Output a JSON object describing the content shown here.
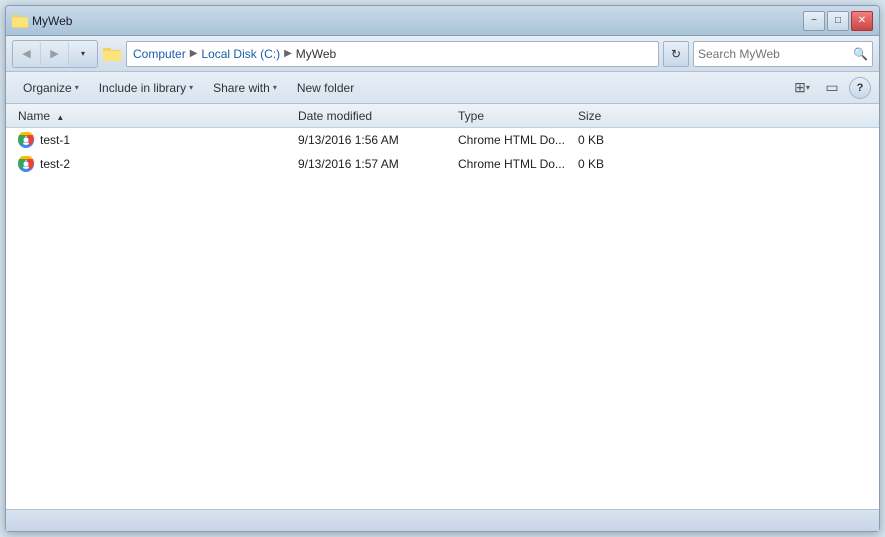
{
  "window": {
    "title": "MyWeb",
    "minimize_label": "−",
    "maximize_label": "□",
    "close_label": "✕"
  },
  "address_bar": {
    "back_label": "◀",
    "forward_label": "▶",
    "dropdown_label": "▾",
    "computer_label": "Computer",
    "localdisk_label": "Local Disk (C:)",
    "current_label": "MyWeb",
    "sep": "▶",
    "refresh_label": "↻",
    "search_placeholder": "Search MyWeb",
    "search_icon_label": "🔍"
  },
  "toolbar": {
    "organize_label": "Organize",
    "include_label": "Include in library",
    "share_label": "Share with",
    "newfolder_label": "New folder",
    "view_label": "▦",
    "view_arrow": "▾",
    "pane_label": "▭",
    "help_label": "?"
  },
  "columns": {
    "name": "Name",
    "date": "Date modified",
    "type": "Type",
    "size": "Size"
  },
  "files": [
    {
      "name": "test-1",
      "date": "9/13/2016 1:56 AM",
      "type": "Chrome HTML Do...",
      "size": "0 KB"
    },
    {
      "name": "test-2",
      "date": "9/13/2016 1:57 AM",
      "type": "Chrome HTML Do...",
      "size": "0 KB"
    }
  ]
}
